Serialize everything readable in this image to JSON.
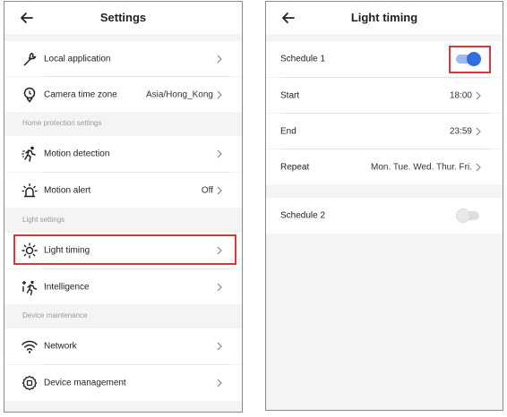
{
  "colors": {
    "accent": "#2f6fe0",
    "highlight": "#d9363e",
    "section_text": "#9a9a9a",
    "background": "#f4f4f5"
  },
  "left_screen": {
    "title": "Settings",
    "rows": {
      "local_application": {
        "label": "Local application",
        "icon": "wrench-icon"
      },
      "camera_time_zone": {
        "label": "Camera time zone",
        "value": "Asia/Hong_Kong",
        "icon": "location-pin-icon"
      },
      "motion_detection": {
        "label": "Motion detection",
        "icon": "running-person-icon"
      },
      "motion_alert": {
        "label": "Motion alert",
        "value": "Off",
        "icon": "alarm-light-icon"
      },
      "light_timing": {
        "label": "Light timing",
        "icon": "sun-icon"
      },
      "intelligence": {
        "label": "Intelligence",
        "icon": "intelligence-icon"
      },
      "network": {
        "label": "Network",
        "icon": "wifi-icon"
      },
      "device_management": {
        "label": "Device management",
        "icon": "device-gear-icon"
      }
    },
    "sections": {
      "home_protection": "Home protection settings",
      "light_settings": "Light settings",
      "device_maintenance": "Device maintenance"
    }
  },
  "right_screen": {
    "title": "Light timing",
    "schedule1": {
      "label": "Schedule 1",
      "enabled": true
    },
    "start": {
      "label": "Start",
      "value": "18:00"
    },
    "end": {
      "label": "End",
      "value": "23:59"
    },
    "repeat": {
      "label": "Repeat",
      "value": "Mon. Tue. Wed. Thur. Fri."
    },
    "schedule2": {
      "label": "Schedule 2",
      "enabled": false
    }
  }
}
